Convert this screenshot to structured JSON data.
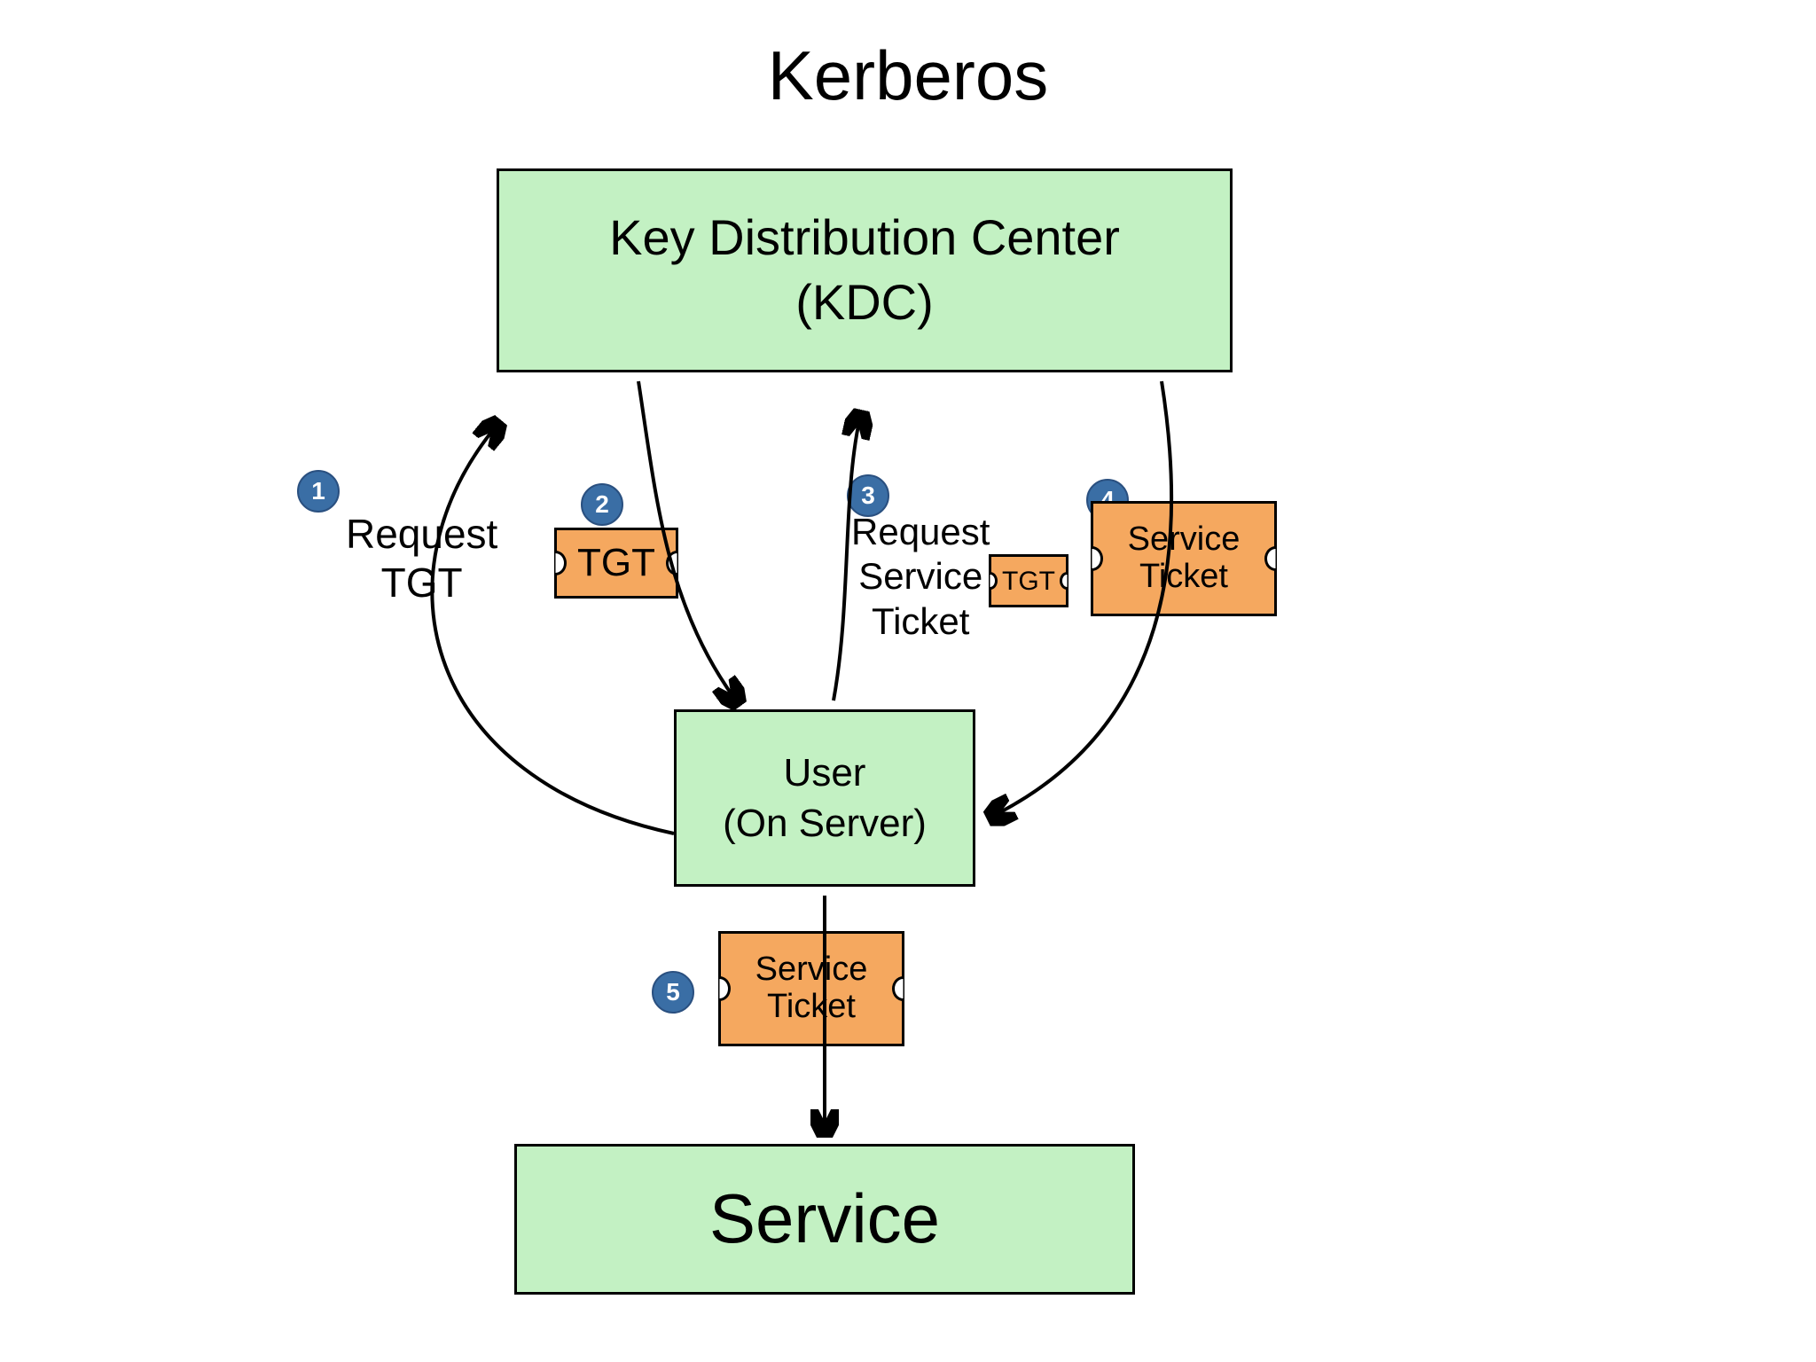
{
  "title": "Kerberos",
  "boxes": {
    "kdc": {
      "line1": "Key Distribution Center",
      "line2": "(KDC)"
    },
    "user": {
      "line1": "User",
      "line2": "(On Server)"
    },
    "service": {
      "label": "Service"
    }
  },
  "steps": {
    "s1": {
      "num": "1",
      "line1": "Request",
      "line2": "TGT"
    },
    "s2": {
      "num": "2",
      "ticket": "TGT"
    },
    "s3": {
      "num": "3",
      "line1": "Request",
      "line2": "Service",
      "line3": "Ticket",
      "ticket": "TGT"
    },
    "s4": {
      "num": "4",
      "ticket_line1": "Service",
      "ticket_line2": "Ticket"
    },
    "s5": {
      "num": "5",
      "ticket_line1": "Service",
      "ticket_line2": "Ticket"
    }
  }
}
